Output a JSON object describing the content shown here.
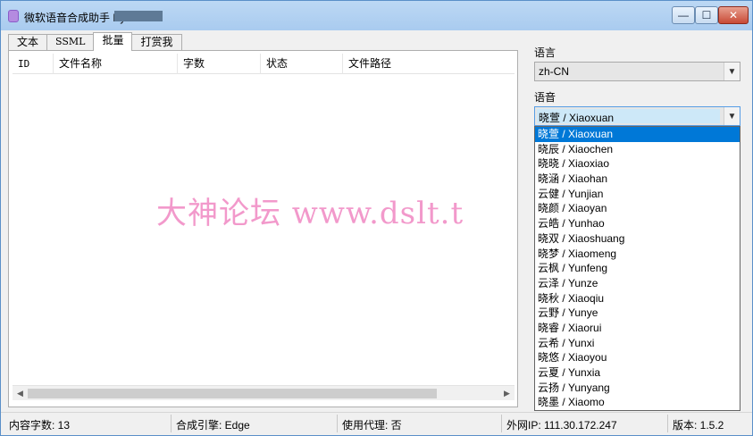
{
  "window": {
    "title": "微软语音合成助手 By",
    "controls": {
      "minimize": "—",
      "maximize": "☐",
      "close": "✕"
    }
  },
  "tabs": [
    {
      "label": "文本"
    },
    {
      "label": "SSML"
    },
    {
      "label": "批量"
    },
    {
      "label": "打赏我"
    }
  ],
  "list": {
    "columns": [
      "ID",
      "文件名称",
      "字数",
      "状态",
      "文件路径"
    ]
  },
  "watermark": "大神论坛  www.dslt.t",
  "sidebar": {
    "language_label": "语言",
    "language_value": "zh-CN",
    "voice_label": "语音",
    "voice_value": "晓萱 / Xiaoxuan",
    "voice_options": [
      "晓萱 / Xiaoxuan",
      "晓辰 / Xiaochen",
      "晓晓 / Xiaoxiao",
      "晓涵 / Xiaohan",
      "云健 / Yunjian",
      "晓颜 / Xiaoyan",
      "云皓 / Yunhao",
      "晓双 / Xiaoshuang",
      "晓梦 / Xiaomeng",
      "云枫 / Yunfeng",
      "云泽 / Yunze",
      "晓秋 / Xiaoqiu",
      "云野 / Yunye",
      "晓睿 / Xiaorui",
      "云希 / Yunxi",
      "晓悠 / Xiaoyou",
      "云夏 / Yunxia",
      "云扬 / Yunyang",
      "晓墨 / Xiaomo"
    ],
    "selected_index": 0
  },
  "status": {
    "char_count": "内容字数: 13",
    "engine": "合成引擎: Edge",
    "proxy": "使用代理: 否",
    "ip": "外网IP: 111.30.172.247",
    "version": "版本: 1.5.2"
  }
}
